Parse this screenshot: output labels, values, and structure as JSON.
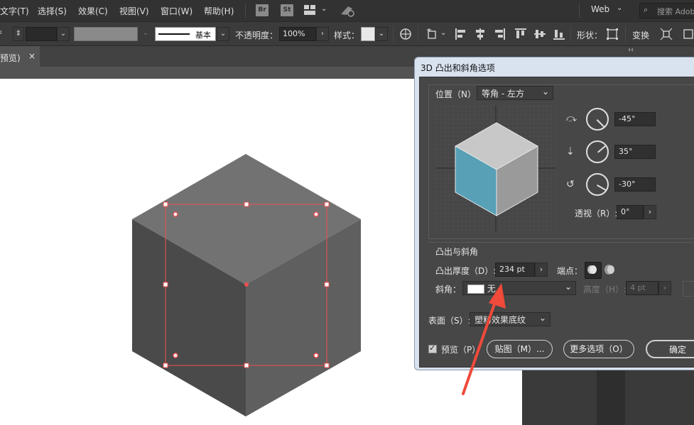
{
  "menu": {
    "items": [
      "文字(T)",
      "选择(S)",
      "效果(C)",
      "视图(V)",
      "窗口(W)",
      "帮助(H)"
    ],
    "bridge_badge": "Br",
    "stock_badge": "St",
    "workspace": "Web",
    "search_placeholder": "搜索 Adobe"
  },
  "control": {
    "opacity_label": "不透明度：",
    "opacity_value": "100%",
    "stroke_label": "基本",
    "style_label": "样式：",
    "shape_label": "形状：",
    "transform_label": "变换"
  },
  "tab": {
    "name": "预览)",
    "close": "×"
  },
  "collapse_chevron": "‹‹",
  "dialog": {
    "title": "3D 凸出和斜角选项",
    "position_label": "位置（N）:",
    "position_value": "等角 - 左方",
    "rot_x": "-45°",
    "rot_y": "35°",
    "rot_z": "-30°",
    "perspective_label": "透视（R）:",
    "perspective_value": "0°",
    "extrude_section": "凸出与斜角",
    "depth_label": "凸出厚度（D）:",
    "depth_value": "234 pt",
    "cap_label": "端点：",
    "bevel_label": "斜角：",
    "bevel_value": "无",
    "height_label": "高度（H）:",
    "height_value": "4 pt",
    "surface_label": "表面（S）:",
    "surface_value": "塑料效果底纹",
    "preview_label": "预览（P）",
    "map_button": "贴图（M）...",
    "more_button": "更多选项（O）",
    "ok_button": "确定"
  },
  "colors": {
    "cube_top": "#727272",
    "cube_left": "#4a4a4a",
    "cube_right": "#5f5f5f",
    "preview_front": "#57a0b6",
    "selection": "#f05050",
    "arrow": "#f04a3a"
  }
}
